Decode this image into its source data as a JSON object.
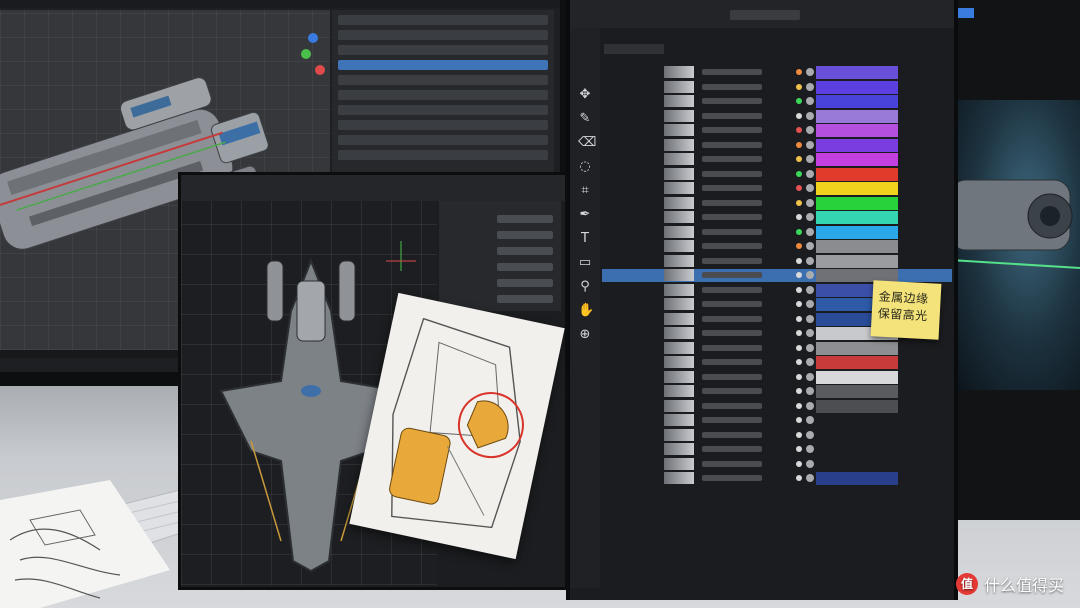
{
  "sticky_note": {
    "line1": "金属边缘",
    "line2": "保留高光"
  },
  "watermark": {
    "logo": "值",
    "text": "什么值得买"
  },
  "colors": {
    "selection": "#3b6fb0",
    "sketch_highlight": "#e8a93a",
    "annotation_circle": "#d9342b",
    "sticky": "#f3e37a"
  },
  "layer_panel": {
    "swatches": [
      "#6a4fd8",
      "#5b3fe0",
      "#4a43d9",
      "#9a7ad8",
      "#b44fe0",
      "#7a3ee0",
      "#c43fe0",
      "#e13b2c",
      "#f1d21c",
      "#28d23a",
      "#33d6b0",
      "#2aa8e8",
      "#8a8c90",
      "#9a9ca0",
      "#6f7176",
      "#3b4fa8",
      "#2e5aa8",
      "#2a4c98",
      "#c8c9cc",
      "#8e8f93",
      "#c73b3b",
      "#d8d8da",
      "#5a5b5f",
      "#4d4e52",
      "#1b1c1f",
      "#1b1c1f",
      "#1b1c1f",
      "#1b1c1f",
      "#2a3f8c"
    ],
    "dot_colors": [
      "#f08a3c",
      "#f0c24c",
      "#3cd85a",
      "#d9d9d9",
      "#e35252",
      "#f08a3c",
      "#f0c24c",
      "#3cd85a",
      "#e35252",
      "#f0c24c",
      "#d9d9d9",
      "#3cd85a",
      "#f08a3c",
      "#d9d9d9",
      "#d9d9d9",
      "#d9d9d9",
      "#d9d9d9",
      "#d9d9d9",
      "#d9d9d9",
      "#d9d9d9",
      "#d9d9d9",
      "#d9d9d9",
      "#d9d9d9",
      "#d9d9d9",
      "#d9d9d9",
      "#d9d9d9",
      "#d9d9d9",
      "#d9d9d9",
      "#d9d9d9"
    ]
  },
  "icons": {
    "tools": [
      "move-icon",
      "brush-icon",
      "eraser-icon",
      "lasso-icon",
      "crop-icon",
      "pen-icon",
      "text-icon",
      "shape-icon",
      "eyedropper-icon",
      "hand-icon",
      "zoom-icon"
    ],
    "glyphs": [
      "✥",
      "✎",
      "⌫",
      "◌",
      "⌗",
      "✒",
      "T",
      "▭",
      "⚲",
      "✋",
      "⊕"
    ]
  }
}
